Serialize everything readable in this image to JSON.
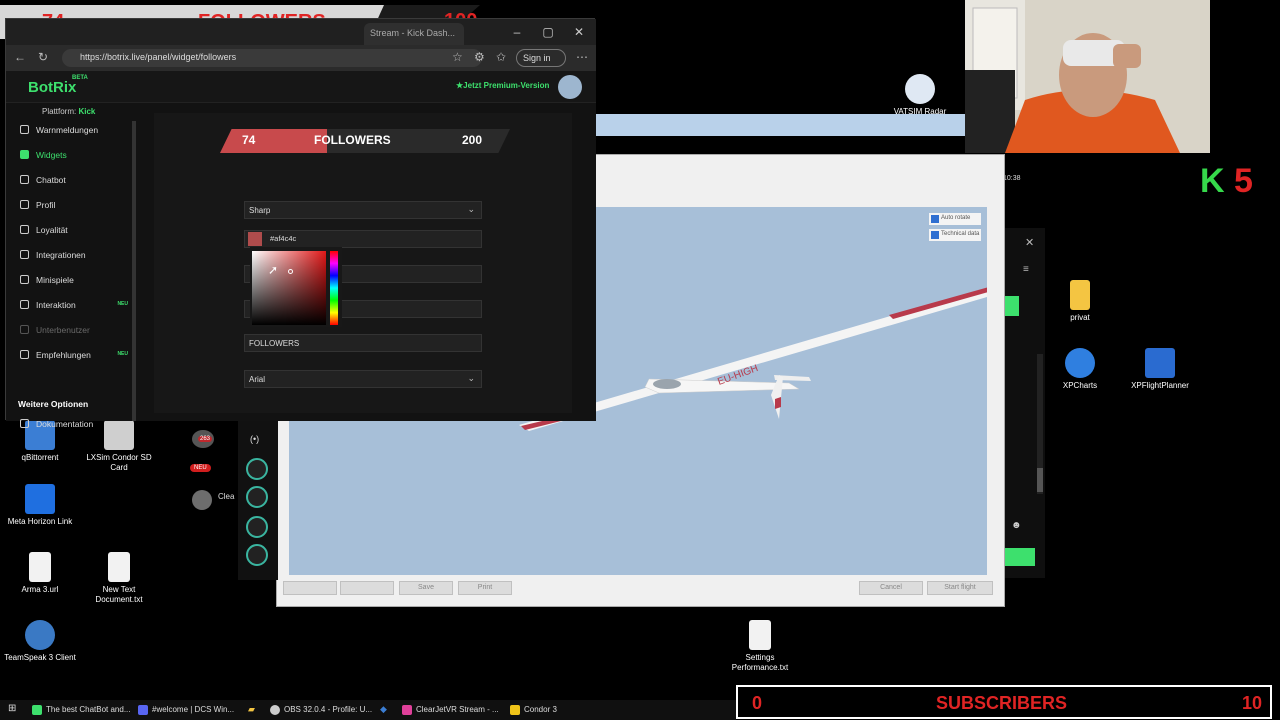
{
  "overlay_top": {
    "count": "74",
    "label": "FOLLOWERS",
    "goal": "100"
  },
  "browser": {
    "tab_title": "Stream - Kick Dash...",
    "url": "https://botrix.live/panel/widget/followers",
    "signin": "Sign in"
  },
  "botrix": {
    "logo": "BotRix",
    "beta": "BETA",
    "premium": "★Jetzt Premium-Version",
    "platform_label": "Plattform:",
    "platform_value": "Kick",
    "sidebar": [
      {
        "label": "Warnmeldungen",
        "state": "normal"
      },
      {
        "label": "Widgets",
        "state": "active"
      },
      {
        "label": "Chatbot",
        "state": "normal"
      },
      {
        "label": "Profil",
        "state": "normal"
      },
      {
        "label": "Loyalität",
        "state": "normal"
      },
      {
        "label": "Integrationen",
        "state": "normal"
      },
      {
        "label": "Minispiele",
        "state": "normal"
      },
      {
        "label": "Interaktion",
        "state": "new"
      },
      {
        "label": "Unterbenutzer",
        "state": "dim"
      },
      {
        "label": "Empfehlungen",
        "state": "new"
      }
    ],
    "sidebar_badge": "NEU",
    "more_options": "Weitere Optionen",
    "documentation": "Dokumentation",
    "preview": {
      "count": "74",
      "label": "FOLLOWERS",
      "goal": "200",
      "progress": 0.37
    },
    "style_select": "Sharp",
    "color_hex": "#af4c4c",
    "text_field": "FOLLOWERS",
    "font_select": "Arial"
  },
  "desktop_icons": [
    {
      "label": "qBittorrent",
      "color": "#3b7ed4"
    },
    {
      "label": "LXSim Condor SD Card",
      "color": "#cfcfcf"
    },
    {
      "label": "Meta Horizon Link",
      "color": "#1f6fe0"
    },
    {
      "label": "Arma 3.url",
      "color": "#f2f2f2"
    },
    {
      "label": "New Text Document.txt",
      "color": "#f2f2f2"
    },
    {
      "label": "TeamSpeak 3 Client",
      "color": "#3a79c4"
    },
    {
      "label": "privat",
      "color": "#f4c542"
    },
    {
      "label": "XPCharts",
      "color": "#2f7fe0"
    },
    {
      "label": "XPFlightPlanner",
      "color": "#2a6bd0"
    },
    {
      "label": "Settings Performance.txt",
      "color": "#f2f2f2"
    },
    {
      "label": "VATSIM Radar",
      "color": "#dfe8f3"
    }
  ],
  "condor": {
    "checkbox_autorotate": "Auto rotate",
    "checkbox_technical": "Technical data",
    "btn_save": "Save",
    "btn_print": "Print",
    "btn_cancel": "Cancel",
    "btn_start": "Start flight",
    "glider_reg": "EU-HIGH"
  },
  "chat": {
    "badge_count": "263",
    "badge_new": "NEU",
    "name_partial": "Clea"
  },
  "clock_partial": "10:38",
  "k5": {
    "k": "K",
    "num": "5"
  },
  "overlay_bottom": {
    "count": "0",
    "label": "SUBSCRIBERS",
    "goal": "10"
  },
  "taskbar": [
    {
      "label": "The best ChatBot and...",
      "color": "#3de06d"
    },
    {
      "label": "#welcome | DCS Win...",
      "color": "#5865f2"
    },
    {
      "label": "OBS 32.0.4 - Profile: U...",
      "color": "#cccccc"
    },
    {
      "label": "ClearJetVR Stream - ...",
      "color": "#e0409a"
    },
    {
      "label": "Condor 3",
      "color": "#f0c419"
    }
  ]
}
